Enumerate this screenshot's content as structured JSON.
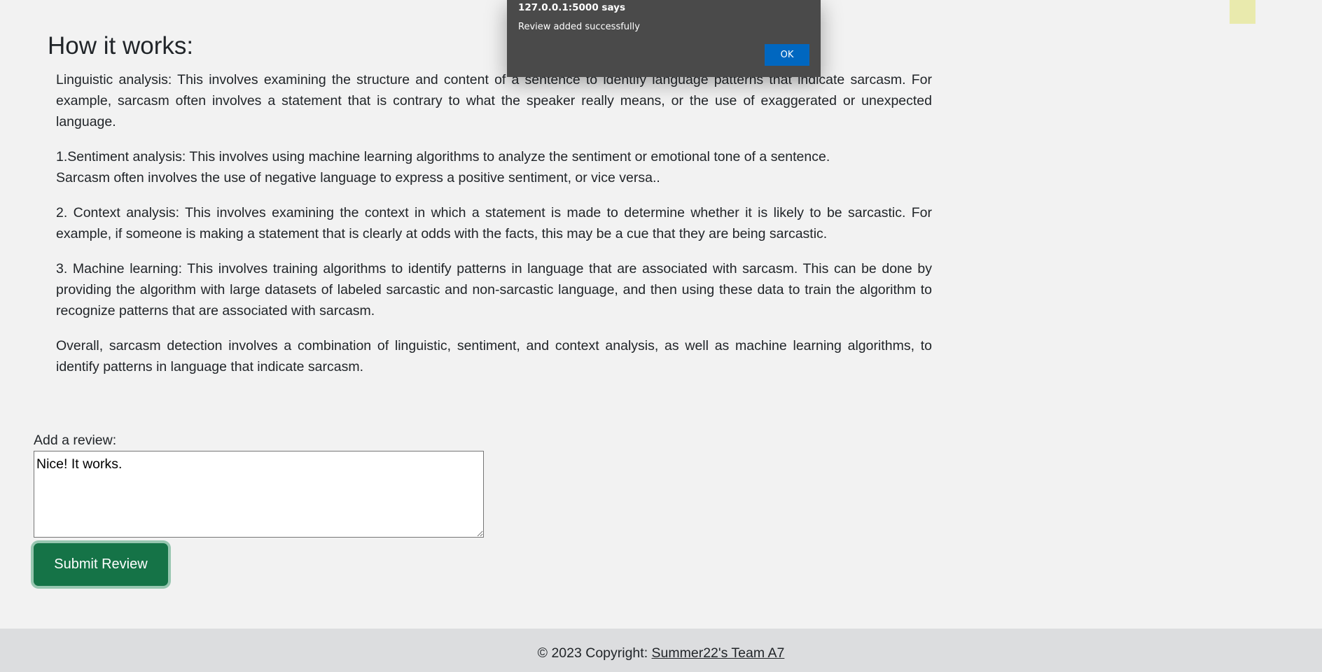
{
  "how_it_works": {
    "title": "How it works:",
    "paragraphs": [
      "Linguistic analysis: This involves examining the structure and content of a sentence to identify language patterns that indicate sarcasm. For example, sarcasm often involves a statement that is contrary to what the speaker really means, or the use of exaggerated or unexpected language.",
      "1.Sentiment analysis: This involves using machine learning algorithms to analyze the sentiment or emotional tone of a sentence.",
      "Sarcasm often involves the use of negative language to express a positive sentiment, or vice versa..",
      "2. Context analysis: This involves examining the context in which a statement is made to determine whether it is likely to be sarcastic. For example, if someone is making a statement that is clearly at odds with the facts, this may be a cue that they are being sarcastic.",
      "3. Machine learning: This involves training algorithms to identify patterns in language that are associated with sarcasm. This can be done by providing the algorithm with large datasets of labeled sarcastic and non-sarcastic language, and then using these data to train the algorithm to recognize patterns that are associated with sarcasm.",
      "Overall, sarcasm detection involves a combination of linguistic, sentiment, and context analysis, as well as machine learning algorithms, to identify patterns in language that indicate sarcasm."
    ]
  },
  "review_form": {
    "label": "Add a review:",
    "value": "Nice! It works.",
    "submit_label": "Submit Review"
  },
  "footer": {
    "copyright": "© 2023 Copyright: ",
    "link_text": "Summer22's Team A7"
  },
  "alert": {
    "title": "127.0.0.1:5000 says",
    "message": "Review added successfully",
    "ok_label": "OK"
  },
  "colors": {
    "background": "#f2f2f2",
    "submit_button": "#157347",
    "footer_background": "#dcdddf",
    "alert_background": "#4a4a4a",
    "alert_ok_button": "#0067c0",
    "corner_square": "#e9eaad"
  }
}
